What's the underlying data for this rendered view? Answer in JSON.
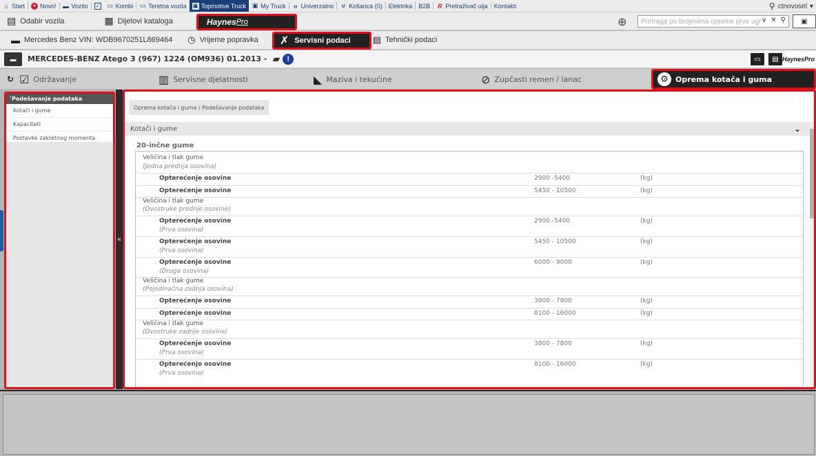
{
  "topnav": {
    "items": [
      {
        "label": "Start",
        "icon": "home-icon"
      },
      {
        "label": "Novo!",
        "icon": "new-icon"
      },
      {
        "label": "Vozilo",
        "icon": "car-icon"
      },
      {
        "label": "",
        "icon": "checkbox-icon"
      },
      {
        "label": "Kombi",
        "icon": "van-icon"
      },
      {
        "label": "Teretna vozila",
        "icon": "truck-icon"
      },
      {
        "label": "Topmotive Truck",
        "icon": "topmotive-icon"
      },
      {
        "label": "My Truck",
        "icon": "mytruck-icon"
      },
      {
        "label": "Univerzalno",
        "icon": "universal-icon"
      },
      {
        "label": "Košarica (0)",
        "icon": "cart-icon"
      },
      {
        "label": "Elektrika",
        "icon": ""
      },
      {
        "label": "B2B",
        "icon": ""
      },
      {
        "label": "Pretraživač ulja",
        "icon": "oil-icon"
      },
      {
        "label": "Kontakti",
        "icon": ""
      }
    ],
    "user": "ctnovosel"
  },
  "bar2": {
    "odabir": "Odabir vozila",
    "dijelovi": "Dijelovi kataloga",
    "haynes": "Haynes",
    "haynes_pro": "Pro",
    "search_placeholder": "Pretraga po brojevima opreme prve ugr"
  },
  "bar3": {
    "vin": "Mercedes Benz VIN: WDB9670251L869464",
    "vrijeme": "Vrijeme popravka",
    "servisni": "Servisni podaci",
    "tehnicki": "Tehnički podaci"
  },
  "vehicle": {
    "title": "MERCEDES-BENZ Atego 3 (967) 1224 (OM936) 01.2013 -",
    "warn": "!",
    "logo": "HaynesPro"
  },
  "tabs": [
    {
      "label": "Održavanje",
      "icon": "checklist-icon"
    },
    {
      "label": "Servisne djelatnosti",
      "icon": "book-icon"
    },
    {
      "label": "Maziva i tekućine",
      "icon": "oilcan-icon"
    },
    {
      "label": "Zupčasti remen / lanac",
      "icon": "belt-icon"
    },
    {
      "label": "Oprema kotača i guma",
      "icon": "wheel-icon"
    }
  ],
  "sidebar": {
    "head": "Podešavanje podataka",
    "items": [
      "Kotači i gume",
      "Kapaciteti",
      "Postavke zakretnog momenta"
    ]
  },
  "main": {
    "breadcrumb": "Oprema kotača i guma  /  Podešavanje podataka",
    "section": "Kotači i gume",
    "subhead": "20-inčne gume",
    "rows": [
      {
        "t": "g",
        "label": "Veličina i tlak gume"
      },
      {
        "t": "s",
        "label": "(Jedna prednja osovina)"
      },
      {
        "t": "d",
        "label": "Opterećenje osovine",
        "value": "2900 -5400",
        "unit": "(kg)"
      },
      {
        "t": "d",
        "label": "Opterećenje osovine",
        "value": "5450 - 10500",
        "unit": "(kg)"
      },
      {
        "t": "g",
        "label": "Veličina i tlak gume"
      },
      {
        "t": "s",
        "label": "(Dvostruke prednje osovine)"
      },
      {
        "t": "d",
        "label": "Opterećenje osovine",
        "value": "2900 -5400",
        "unit": "(kg)"
      },
      {
        "t": "si",
        "label": "(Prva osovina)"
      },
      {
        "t": "d",
        "label": "Opterećenje osovine",
        "value": "5450 - 10500",
        "unit": "(kg)"
      },
      {
        "t": "si",
        "label": "(Prva osovina)"
      },
      {
        "t": "d",
        "label": "Opterećenje osovine",
        "value": "6000 - 9000",
        "unit": "(kg)"
      },
      {
        "t": "si",
        "label": "(Druga osovina)"
      },
      {
        "t": "g",
        "label": "Veličina i tlak gume"
      },
      {
        "t": "s",
        "label": "(Pojedinačna zadnja osovina)"
      },
      {
        "t": "d",
        "label": "Opterećenje osovine",
        "value": "3800 - 7800",
        "unit": "(kg)"
      },
      {
        "t": "d",
        "label": "Opterećenje osovine",
        "value": "8100 - 16000",
        "unit": "(kg)"
      },
      {
        "t": "g",
        "label": "Veličina i tlak gume"
      },
      {
        "t": "s",
        "label": "(Dvostruke zadnje osovine)"
      },
      {
        "t": "d",
        "label": "Opterećenje osovine",
        "value": "3800 - 7800",
        "unit": "(kg)"
      },
      {
        "t": "si",
        "label": "(Prva osovina)"
      },
      {
        "t": "d",
        "label": "Opterećenje osovine",
        "value": "8100 - 16000",
        "unit": "(kg)"
      },
      {
        "t": "si",
        "label": "(Prva osovina)"
      }
    ]
  }
}
